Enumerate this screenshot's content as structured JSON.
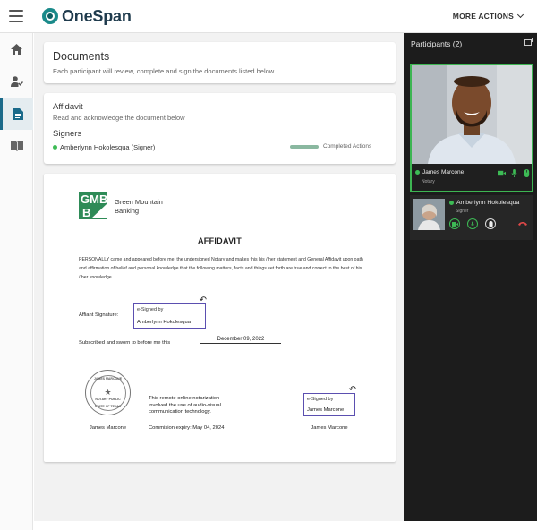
{
  "header": {
    "brand": "OneSpan",
    "more_actions": "MORE ACTIONS"
  },
  "nav": {
    "items": [
      {
        "icon": "home-icon"
      },
      {
        "icon": "user-check-icon"
      },
      {
        "icon": "document-icon",
        "active": true
      },
      {
        "icon": "book-icon"
      }
    ]
  },
  "documents_card": {
    "title": "Documents",
    "subtitle": "Each participant will review, complete and sign the documents listed below"
  },
  "affidavit_card": {
    "title": "Affidavit",
    "subtitle": "Read and acknowledge the document below",
    "signers_label": "Signers",
    "signer_name": "Amberlynn Hokolesqua (Signer)",
    "status": "Completed Actions",
    "progress": 1.0
  },
  "document": {
    "bank_logo": "GMB",
    "bank_name_1": "Green Mountain",
    "bank_name_2": "Banking",
    "title": "AFFIDAVIT",
    "body": "PERSONALLY came and appeared before me, the undersigned Notary and makes this his / her statement and General Affidavit upon oath and affirmation of belief and personal knowledge that the following matters, facts and things set forth are true and correct to the best of his / her knowledge.",
    "affiant_label": "Affiant Signature:",
    "esig_by": "e-Signed by",
    "affiant_name": "Amberlynn Hokolesqua",
    "sworn_label": "Subscribed and sworn to before me this",
    "sworn_date": "December 09, 2022",
    "seal_top": "JAMES MARCONE",
    "seal_mid": "NOTARY PUBLIC",
    "seal_bottom": "STATE OF TEXAS",
    "seal_name": "James Marcone",
    "remote_text": "This remote online notarization involved the use of audio-visual communication technology.",
    "commission": "Commision expiry:  May 04, 2024",
    "notary_esig_by": "e-Signed by",
    "notary_esig_name": "James Marcone",
    "notary_name": "James Marcone"
  },
  "participants": {
    "title": "Participants (2)",
    "main": {
      "name": "James Marcone",
      "role": "Notary"
    },
    "tile": {
      "name": "Amberlynn Hokolesqua",
      "role": "Signer"
    }
  },
  "colors": {
    "accent": "#1a6a8a",
    "online": "#3dbb55",
    "signature_border": "#5b4fb0",
    "end_call": "#e04848"
  }
}
